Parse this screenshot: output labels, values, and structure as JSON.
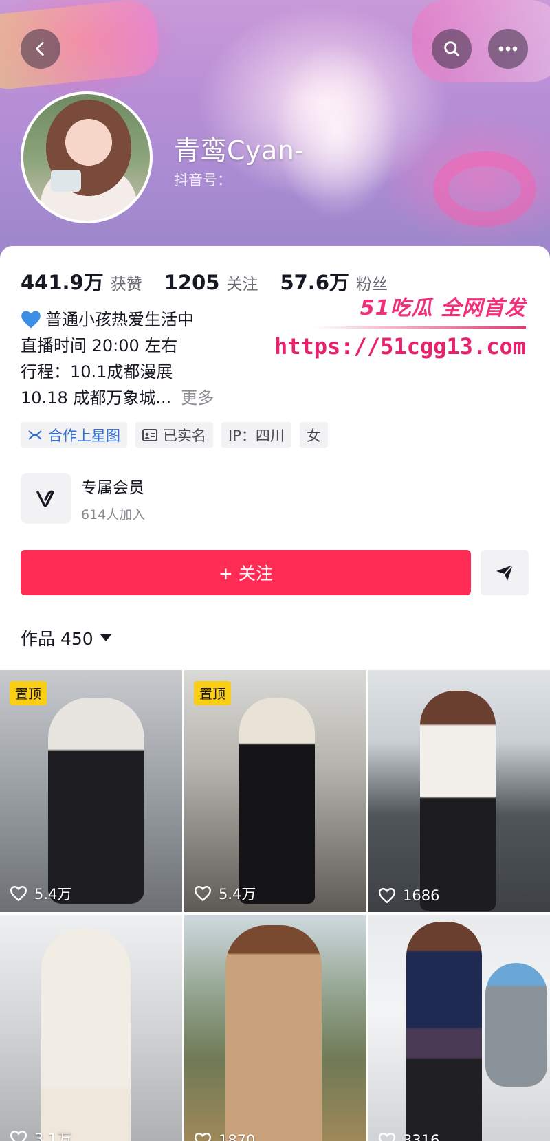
{
  "header": {
    "name": "青鸾Cyan-",
    "douyin_id_label": "抖音号："
  },
  "stats": [
    {
      "value": "441.9万",
      "label": "获赞"
    },
    {
      "value": "1205",
      "label": "关注"
    },
    {
      "value": "57.6万",
      "label": "粉丝"
    }
  ],
  "bio": {
    "line1": "普通小孩热爱生活中",
    "line2": "直播时间 20:00 左右",
    "line3": "行程：10.1成都漫展",
    "line4": "10.18 成都万象城...",
    "more": "更多"
  },
  "watermark": {
    "title": "51吃瓜 全网首发",
    "url": "https://51cgg13.com"
  },
  "tags": {
    "cooperate": "合作上星图",
    "verified": "已实名",
    "ip": "IP：四川",
    "gender": "女"
  },
  "member": {
    "title": "专属会员",
    "subtitle": "614人加入"
  },
  "follow_label": "+ 关注",
  "works": {
    "label": "作品 450"
  },
  "grid": [
    {
      "pinned": "置顶",
      "likes": "5.4万"
    },
    {
      "pinned": "置顶",
      "likes": "5.4万"
    },
    {
      "pinned": "",
      "likes": "1686"
    },
    {
      "pinned": "",
      "likes": "3.1万"
    },
    {
      "pinned": "",
      "likes": "1870"
    },
    {
      "pinned": "",
      "likes": "3316"
    }
  ],
  "colors": {
    "accent": "#fe2c55",
    "pin": "#face15",
    "link": "#2f6fd6",
    "watermark": "#f0307a"
  }
}
